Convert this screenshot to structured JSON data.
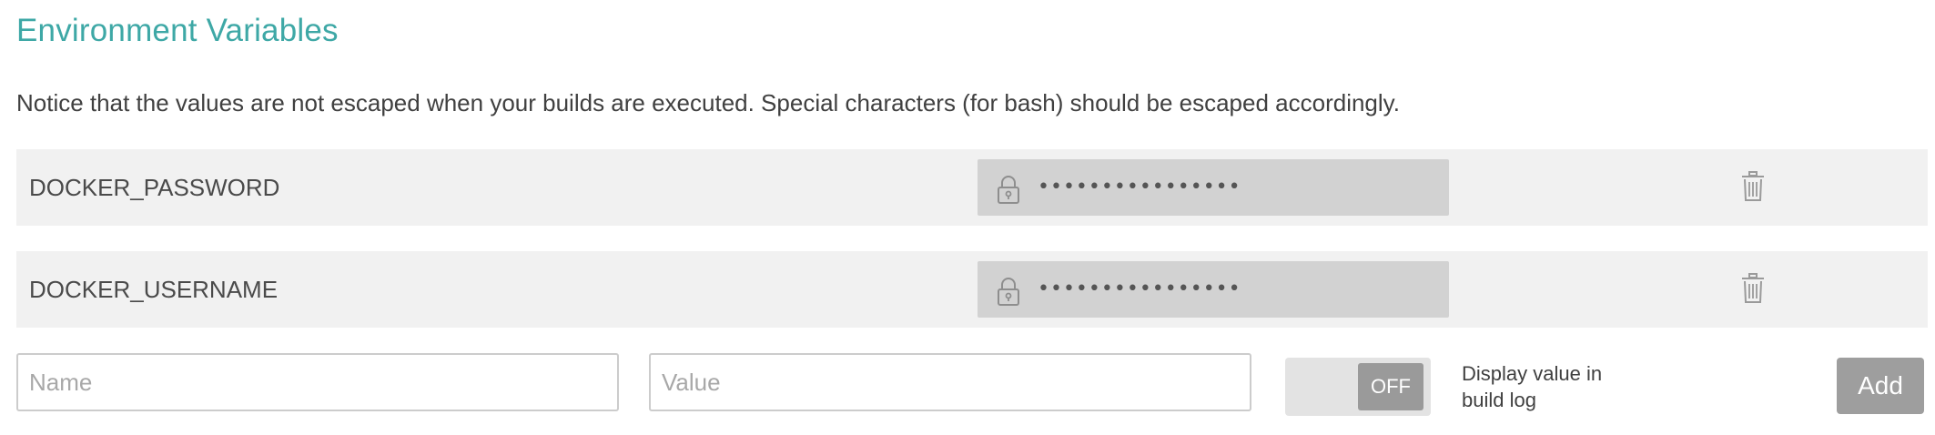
{
  "section": {
    "title": "Environment Variables",
    "notice": "Notice that the values are not escaped when your builds are executed. Special characters (for bash) should be escaped accordingly."
  },
  "variables": [
    {
      "name": "DOCKER_PASSWORD",
      "masked_value": "••••••••••••••••",
      "lock_icon": "lock-icon",
      "delete_icon": "trash-icon"
    },
    {
      "name": "DOCKER_USERNAME",
      "masked_value": "••••••••••••••••",
      "lock_icon": "lock-icon",
      "delete_icon": "trash-icon"
    }
  ],
  "new_variable": {
    "name_placeholder": "Name",
    "value_placeholder": "Value",
    "toggle_state": "OFF",
    "toggle_label_line1": "Display value in",
    "toggle_label_line2": "build log",
    "add_label": "Add"
  },
  "colors": {
    "title": "#3ea8a6",
    "row_background": "#f1f1f1",
    "masked_box": "#d2d2d2",
    "button": "#9e9e9e"
  }
}
